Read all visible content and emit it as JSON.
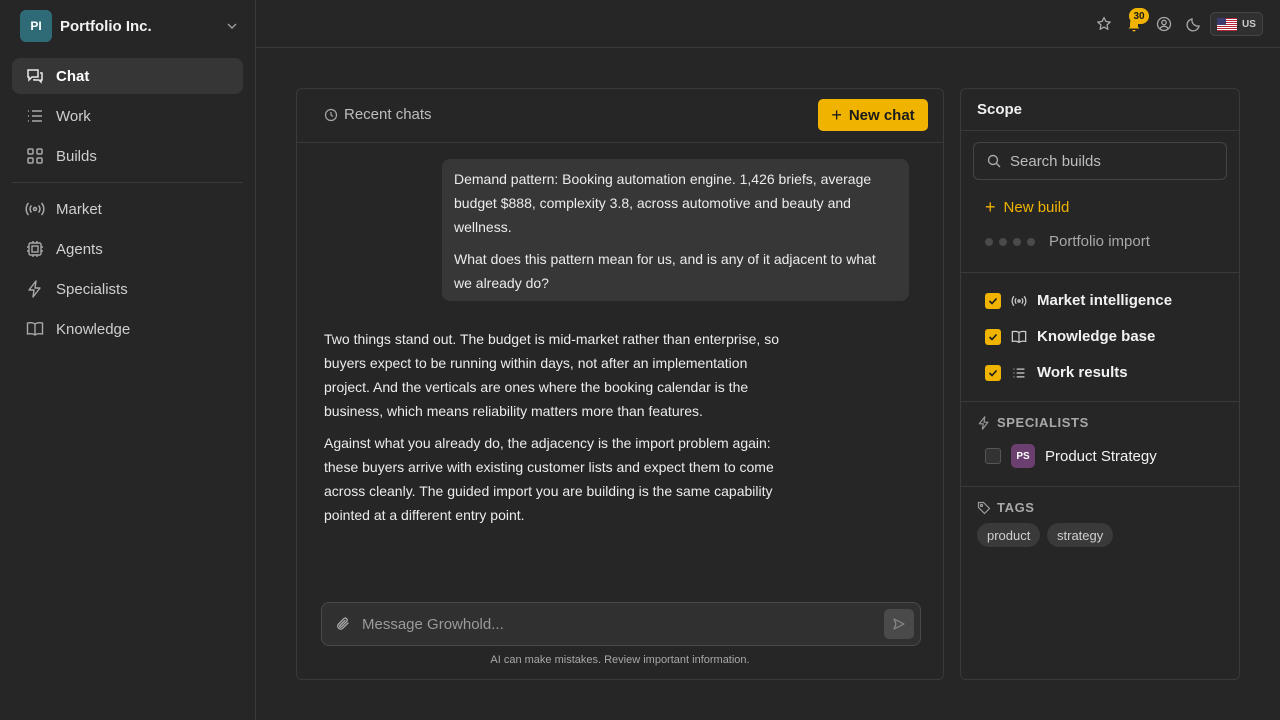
{
  "org": {
    "initials": "PI",
    "name": "Portfolio Inc."
  },
  "nav": {
    "items": [
      {
        "label": "Chat",
        "icon": "chat-icon",
        "active": true
      },
      {
        "label": "Work",
        "icon": "list-icon"
      },
      {
        "label": "Builds",
        "icon": "grid-icon"
      },
      {
        "label": "Market",
        "icon": "broadcast-icon"
      },
      {
        "label": "Agents",
        "icon": "cpu-icon"
      },
      {
        "label": "Specialists",
        "icon": "bolt-icon"
      },
      {
        "label": "Knowledge",
        "icon": "book-icon"
      }
    ]
  },
  "topbar": {
    "notifications": "30",
    "locale": "US"
  },
  "chat": {
    "recent_label": "Recent chats",
    "new_chat_label": "New chat",
    "user_message": [
      "Demand pattern: Booking automation engine. 1,426 briefs, average budget $888, complexity 3.8, across automotive and beauty and wellness.",
      "What does this pattern mean for us, and is any of it adjacent to what we already do?"
    ],
    "ai_message": [
      "Two things stand out. The budget is mid-market rather than enterprise, so buyers expect to be running within days, not after an implementation project. And the verticals are ones where the booking calendar is the business, which means reliability matters more than features.",
      "Against what you already do, the adjacency is the import problem again: these buyers arrive with existing customer lists and expect them to come across cleanly. The guided import you are building is the same capability pointed at a different entry point."
    ],
    "composer_placeholder": "Message Growhold...",
    "disclaimer": "AI can make mistakes. Review important information."
  },
  "scope": {
    "title": "Scope",
    "search_placeholder": "Search builds",
    "new_build_label": "New build",
    "import_label": "Portfolio import",
    "sources": [
      {
        "label": "Market intelligence",
        "checked": true
      },
      {
        "label": "Knowledge base",
        "checked": true
      },
      {
        "label": "Work results",
        "checked": true
      }
    ],
    "specialists_heading": "SPECIALISTS",
    "specialist": {
      "initials": "PS",
      "label": "Product Strategy",
      "checked": false
    },
    "tags_heading": "TAGS",
    "tags": [
      "product",
      "strategy"
    ]
  },
  "colors": {
    "accent": "#f0b400",
    "background": "#262626",
    "org_avatar": "#2e6b76",
    "specialist_avatar": "#6b3f6f"
  }
}
